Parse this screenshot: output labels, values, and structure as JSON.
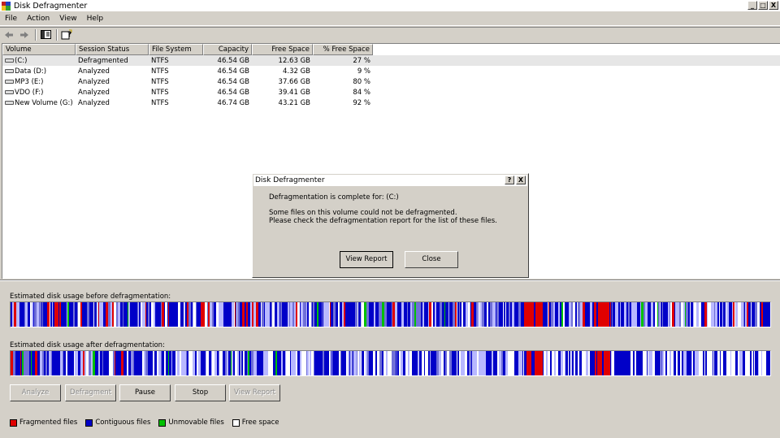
{
  "window": {
    "title": "Disk Defragmenter",
    "controls": [
      "_",
      "□",
      "X"
    ]
  },
  "menu": [
    "File",
    "Action",
    "View",
    "Help"
  ],
  "toolbar": {
    "icons": [
      "back-arrow-icon",
      "forward-arrow-icon",
      "show-hide-console-tree-icon",
      "help-icon"
    ]
  },
  "volumes": {
    "columns": [
      "Volume",
      "Session Status",
      "File System",
      "Capacity",
      "Free Space",
      "% Free Space"
    ],
    "rows": [
      [
        "(C:)",
        "Defragmented",
        "NTFS",
        "46.54 GB",
        "12.63 GB",
        "27 %"
      ],
      [
        "Data (D:)",
        "Analyzed",
        "NTFS",
        "46.54 GB",
        "4.32 GB",
        "9 %"
      ],
      [
        "MP3 (E:)",
        "Analyzed",
        "NTFS",
        "46.54 GB",
        "37.66 GB",
        "80 %"
      ],
      [
        "VDO (F:)",
        "Analyzed",
        "NTFS",
        "46.54 GB",
        "39.41 GB",
        "84 %"
      ],
      [
        "New Volume (G:)",
        "Analyzed",
        "NTFS",
        "46.74 GB",
        "43.21 GB",
        "92 %"
      ]
    ]
  },
  "dialog": {
    "title": "Disk Defragmenter",
    "line1": "Defragmentation is complete for: (C:)",
    "line2": "Some files on this volume could not be defragmented.",
    "line3": "Please check the defragmentation report for the list of these files.",
    "view_report": "View Report",
    "close": "Close",
    "help_btn": "?",
    "close_btn": "X"
  },
  "usage": {
    "before_label": "Estimated disk usage before defragmentation:",
    "after_label": "Estimated disk usage after defragmentation:"
  },
  "actions": {
    "analyze": "Analyze",
    "defragment": "Defragment",
    "pause": "Pause",
    "stop": "Stop",
    "view_report": "View Report"
  },
  "legend": [
    {
      "label": "Fragmented files",
      "color": "#e00000"
    },
    {
      "label": "Contiguous files",
      "color": "#0000c8"
    },
    {
      "label": "Unmovable files",
      "color": "#00c000"
    },
    {
      "label": "Free space",
      "color": "#ffffff"
    }
  ],
  "colors": {
    "fragmented": "#e00000",
    "contiguous": "#0000c8",
    "unmovable": "#00c000",
    "free": "#ffffff",
    "light": "#b8b8ff"
  }
}
